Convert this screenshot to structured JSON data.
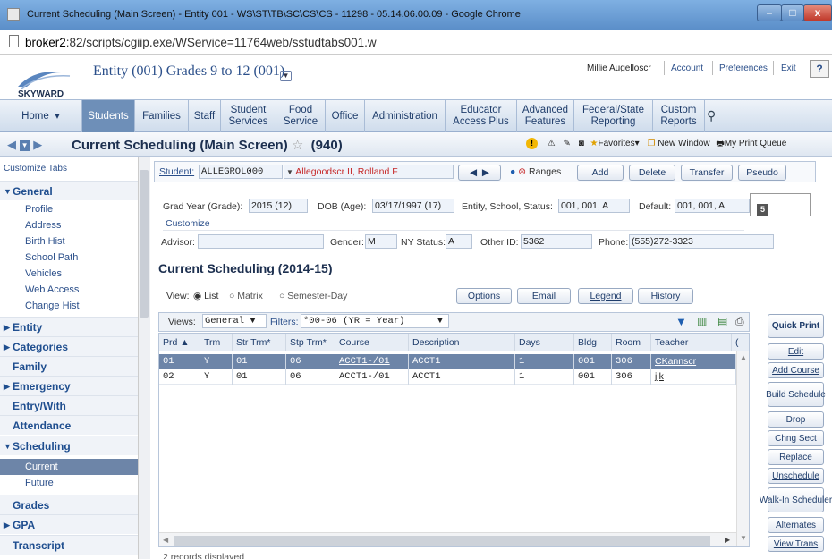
{
  "window": {
    "title": "Current Scheduling (Main Screen) - Entity 001 - WS\\ST\\TB\\SC\\CS\\CS - 11298 - 05.14.06.00.09 - Google Chrome",
    "url_host": "broker2",
    "url_rest": ":82/scripts/cgiip.exe/WService=11764web/sstudtabs001.w"
  },
  "header": {
    "logo_text": "SKYWARD",
    "entity": "Entity (001) Grades 9 to 12 (001)",
    "user": "Millie Augelloscr",
    "links": [
      "Account",
      "Preferences",
      "Exit"
    ],
    "help": "?"
  },
  "nav": {
    "items": [
      "Home",
      "Students",
      "Families",
      "Staff",
      "Student Services",
      "Food Service",
      "Office",
      "Administration",
      "Educator Access Plus",
      "Advanced Features",
      "Federal/State Reporting",
      "Custom Reports"
    ]
  },
  "page": {
    "title": "Current Scheduling (Main Screen)",
    "count": "(940)",
    "toolbar": {
      "favorites": "Favorites",
      "new_window": "New Window",
      "print_queue": "My Print Queue"
    }
  },
  "sidebar": {
    "customize": "Customize Tabs",
    "general": "General",
    "general_items": [
      "Profile",
      "Address",
      "Birth Hist",
      "School Path",
      "Vehicles",
      "Web Access",
      "Change Hist"
    ],
    "entity": "Entity",
    "categories": "Categories",
    "family": "Family",
    "emergency": "Emergency",
    "entry_with": "Entry/With",
    "attendance": "Attendance",
    "scheduling": "Scheduling",
    "scheduling_items": [
      "Current",
      "Future"
    ],
    "grades": "Grades",
    "gpa": "GPA",
    "transcript": "Transcript"
  },
  "student": {
    "label": "Student:",
    "code": "ALLEGROL000",
    "name": "Allegoodscr II, Rolland F",
    "ranges": "Ranges",
    "buttons": [
      "Add",
      "Delete",
      "Transfer",
      "Pseudo"
    ],
    "grad_label": "Grad Year (Grade):",
    "grad": "2015 (12)",
    "dob_label": "DOB (Age):",
    "dob": "03/17/1997 (17)",
    "ess_label": "Entity, School, Status:",
    "ess": "001, 001, A",
    "default_label": "Default:",
    "default": "001, 001, A",
    "badge": "5",
    "customize": "Customize",
    "advisor_label": "Advisor:",
    "advisor": "",
    "gender_label": "Gender:",
    "gender": "M",
    "ny_label": "NY Status:",
    "ny": "A",
    "other_label": "Other ID:",
    "other": "5362",
    "phone_label": "Phone:",
    "phone": "(555)272-3323"
  },
  "schedule": {
    "title": "Current Scheduling (2014-15)",
    "view_label": "View:",
    "views": [
      "List",
      "Matrix",
      "Semester-Day"
    ],
    "actions": [
      "Options",
      "Email",
      "Legend",
      "History"
    ],
    "views_label": "Views:",
    "views_value": "General",
    "filters_label": "Filters:",
    "filters_value": "*00-06 (YR = Year)",
    "columns": [
      "Prd ▲",
      "Trm",
      "Str Trm*",
      "Stp Trm*",
      "Course",
      "Description",
      "Days",
      "Bldg",
      "Room",
      "Teacher",
      "("
    ],
    "rows": [
      [
        "01",
        "Y",
        "01",
        "06",
        "ACCT1-/01",
        "ACCT1",
        "1",
        "001",
        "306",
        "CKannscr"
      ],
      [
        "02",
        "Y",
        "01",
        "06",
        "ACCT1-/01",
        "ACCT1",
        "1",
        "001",
        "306",
        "jjk"
      ]
    ],
    "records": "2 records displayed"
  },
  "right_buttons": [
    "Quick Print",
    "Edit",
    "Add Course",
    "Build Schedule",
    "Drop",
    "Chng Sect",
    "Replace",
    "Unschedule",
    "Walk-In Scheduler",
    "Alternates",
    "View Trans"
  ]
}
